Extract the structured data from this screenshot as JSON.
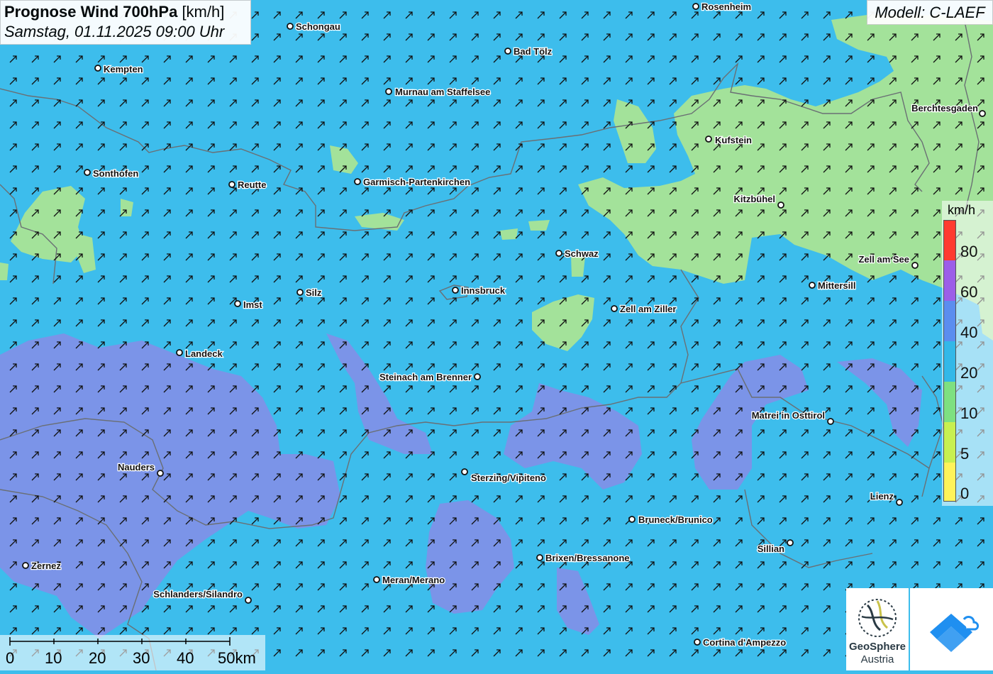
{
  "title": {
    "bold": "Prognose Wind 700hPa",
    "unit": "[km/h]",
    "date": "Samstag, 01.11.2025 09:00 Uhr"
  },
  "model": "Modell: C-LAEF",
  "legend": {
    "unit": "km/h",
    "labels": [
      "80",
      "60",
      "40",
      "20",
      "10",
      "5",
      "0"
    ],
    "colors": [
      "#ff3b30",
      "#9c5ee8",
      "#5b8def",
      "#33b8e8",
      "#7ee081",
      "#c8f050",
      "#fff35a"
    ]
  },
  "scale": {
    "labels": [
      "0",
      "10",
      "20",
      "30",
      "40",
      "50km"
    ]
  },
  "logo": {
    "name": "GeoSphere",
    "sub": "Austria"
  },
  "cities": [
    {
      "name": "Rosenheim"
    },
    {
      "name": "Schongau"
    },
    {
      "name": "Bad Tölz"
    },
    {
      "name": "Kempten"
    },
    {
      "name": "Murnau am Staffelsee"
    },
    {
      "name": "Berchtesgaden"
    },
    {
      "name": "Kufstein"
    },
    {
      "name": "Sonthofen"
    },
    {
      "name": "Reutte"
    },
    {
      "name": "Garmisch-Partenkirchen"
    },
    {
      "name": "Kitzbühel"
    },
    {
      "name": "Schwaz"
    },
    {
      "name": "Zell am See"
    },
    {
      "name": "Mittersill"
    },
    {
      "name": "Silz"
    },
    {
      "name": "Innsbruck"
    },
    {
      "name": "Imst"
    },
    {
      "name": "Zell am Ziller"
    },
    {
      "name": "Landeck"
    },
    {
      "name": "Steinach am Brenner"
    },
    {
      "name": "Matrei in Osttirol"
    },
    {
      "name": "Nauders"
    },
    {
      "name": "Sterzing/Vipiteno"
    },
    {
      "name": "Lienz"
    },
    {
      "name": "Bruneck/Brunico"
    },
    {
      "name": "Sillian"
    },
    {
      "name": "Brixen/Bressanone"
    },
    {
      "name": "Zernez"
    },
    {
      "name": "Meran/Merano"
    },
    {
      "name": "Schlanders/Silandro"
    },
    {
      "name": "Cortina d'Ampezzo"
    }
  ]
}
